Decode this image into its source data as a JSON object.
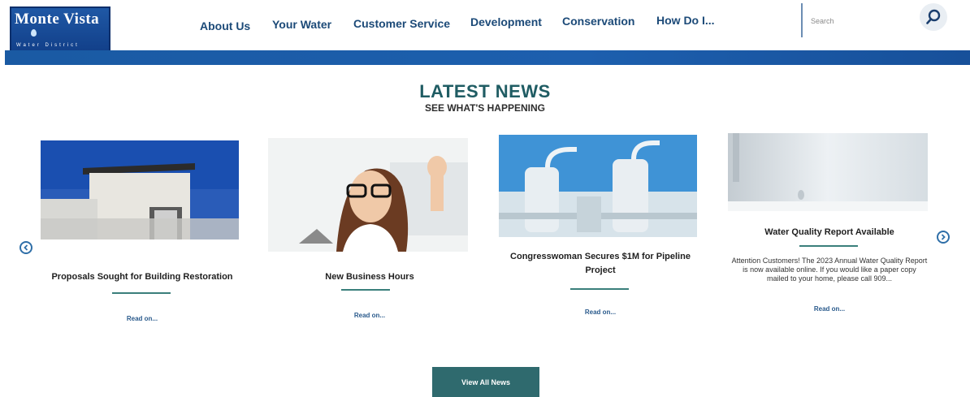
{
  "logo": {
    "title": "Monte Vista",
    "subtitle": "Water District"
  },
  "nav": {
    "items": [
      "About Us",
      "Your Water",
      "Customer Service",
      "Development",
      "Conservation",
      "How Do I..."
    ]
  },
  "search": {
    "placeholder": "Search"
  },
  "news": {
    "title": "LATEST NEWS",
    "subtitle": "SEE WHAT'S HAPPENING",
    "cards": [
      {
        "title": "Proposals Sought for Building Restoration",
        "text": "",
        "link": "Read on..."
      },
      {
        "title": "New Business Hours",
        "text": "",
        "link": "Read on..."
      },
      {
        "title": "Congresswoman Secures $1M for Pipeline Project",
        "text": "",
        "link": "Read on..."
      },
      {
        "title": "Water Quality Report Available",
        "text": "Attention Customers! The 2023 Annual Water Quality Report is now available online. If you would like a paper copy mailed to your home, please call 909...",
        "link": "Read on..."
      }
    ],
    "view_all": "View All News"
  },
  "colors": {
    "brand_blue": "#1d5fae",
    "nav_text": "#1c4a78",
    "teal": "#2f6a6e",
    "accent_rule": "#3a7f7b"
  },
  "icons": {
    "search": "search-icon",
    "prev": "chevron-left-icon",
    "next": "chevron-right-icon"
  }
}
